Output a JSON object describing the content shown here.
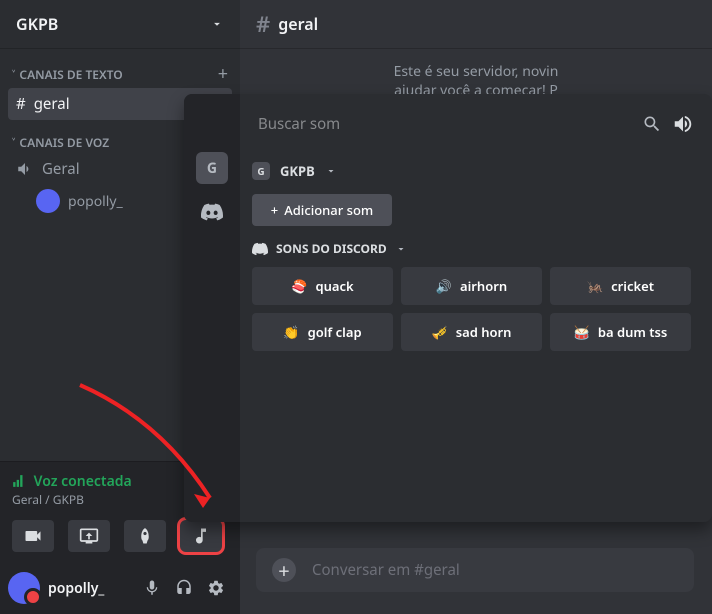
{
  "server": {
    "name": "GKPB"
  },
  "categories": {
    "text": {
      "label": "CANAIS DE TEXTO"
    },
    "voice": {
      "label": "CANAIS DE VOZ"
    }
  },
  "channels": {
    "text": [
      {
        "name": "geral"
      }
    ],
    "voice": [
      {
        "name": "Geral"
      }
    ]
  },
  "voice_users": [
    {
      "name": "popolly_"
    }
  ],
  "voice_status": {
    "label": "Voz conectada",
    "location": "Geral / GKPB"
  },
  "user": {
    "name": "popolly_"
  },
  "header": {
    "channel": "geral"
  },
  "welcome": {
    "line1": "Este é seu servidor, novin",
    "line2": "ajudar você a começar! P"
  },
  "msgbox": {
    "placeholder": "Conversar em #geral"
  },
  "soundboard": {
    "search_placeholder": "Buscar som",
    "server": "GKPB",
    "add_label": "Adicionar som",
    "section": "SONS DO DISCORD",
    "sounds": [
      {
        "emoji": "🍣",
        "name": "quack"
      },
      {
        "emoji": "🔊",
        "name": "airhorn"
      },
      {
        "emoji": "🦗",
        "name": "cricket"
      },
      {
        "emoji": "👏",
        "name": "golf clap"
      },
      {
        "emoji": "🎺",
        "name": "sad horn"
      },
      {
        "emoji": "🥁",
        "name": "ba dum tss"
      }
    ]
  }
}
